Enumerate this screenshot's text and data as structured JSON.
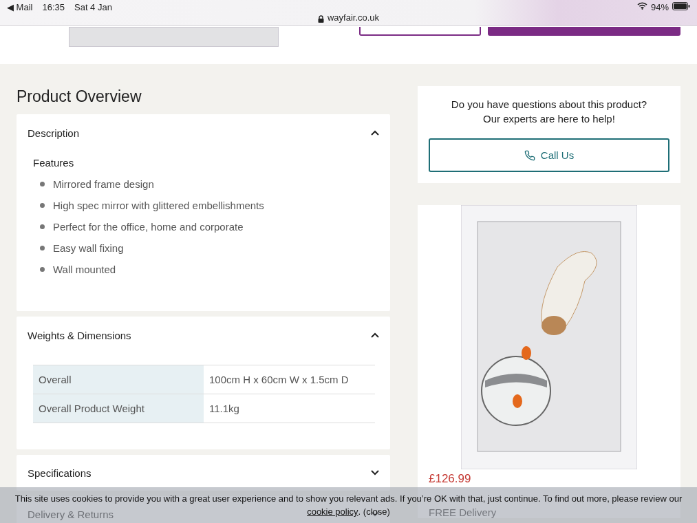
{
  "status_bar": {
    "back": "◀ Mail",
    "time": "16:35",
    "date": "Sat 4 Jan",
    "url": "wayfair.co.uk",
    "battery": "94%"
  },
  "heading": "Product Overview",
  "sections": [
    {
      "kind": "features",
      "title": "Description",
      "expanded": true,
      "subheading": "Features",
      "items": [
        "Mirrored frame design",
        "High spec mirror with glittered embellishments",
        "Perfect for the office, home and corporate",
        "Easy wall fixing",
        "Wall mounted"
      ]
    },
    {
      "kind": "table",
      "title": "Weights & Dimensions",
      "expanded": true,
      "rows": [
        {
          "label": "Overall",
          "value": "100cm H x 60cm W x 1.5cm D"
        },
        {
          "label": "Overall Product Weight",
          "value": "11.1kg"
        }
      ]
    },
    {
      "kind": "plain",
      "title": "Specifications",
      "expanded": false
    },
    {
      "kind": "plain",
      "title": "Delivery & Returns",
      "expanded": false
    }
  ],
  "help": {
    "lines": [
      "Do you have questions about this product?",
      "Our experts are here to help!"
    ],
    "button": "Call Us"
  },
  "product": {
    "price": "£126.99",
    "delivery": "FREE Delivery"
  },
  "cookie_banner": {
    "text": "This site uses cookies to provide you with a great user experience and to show you relevant ads. If you’re OK with that, just continue. To find out more, please review our",
    "link": "cookie policy",
    "tail": ". (close)"
  }
}
